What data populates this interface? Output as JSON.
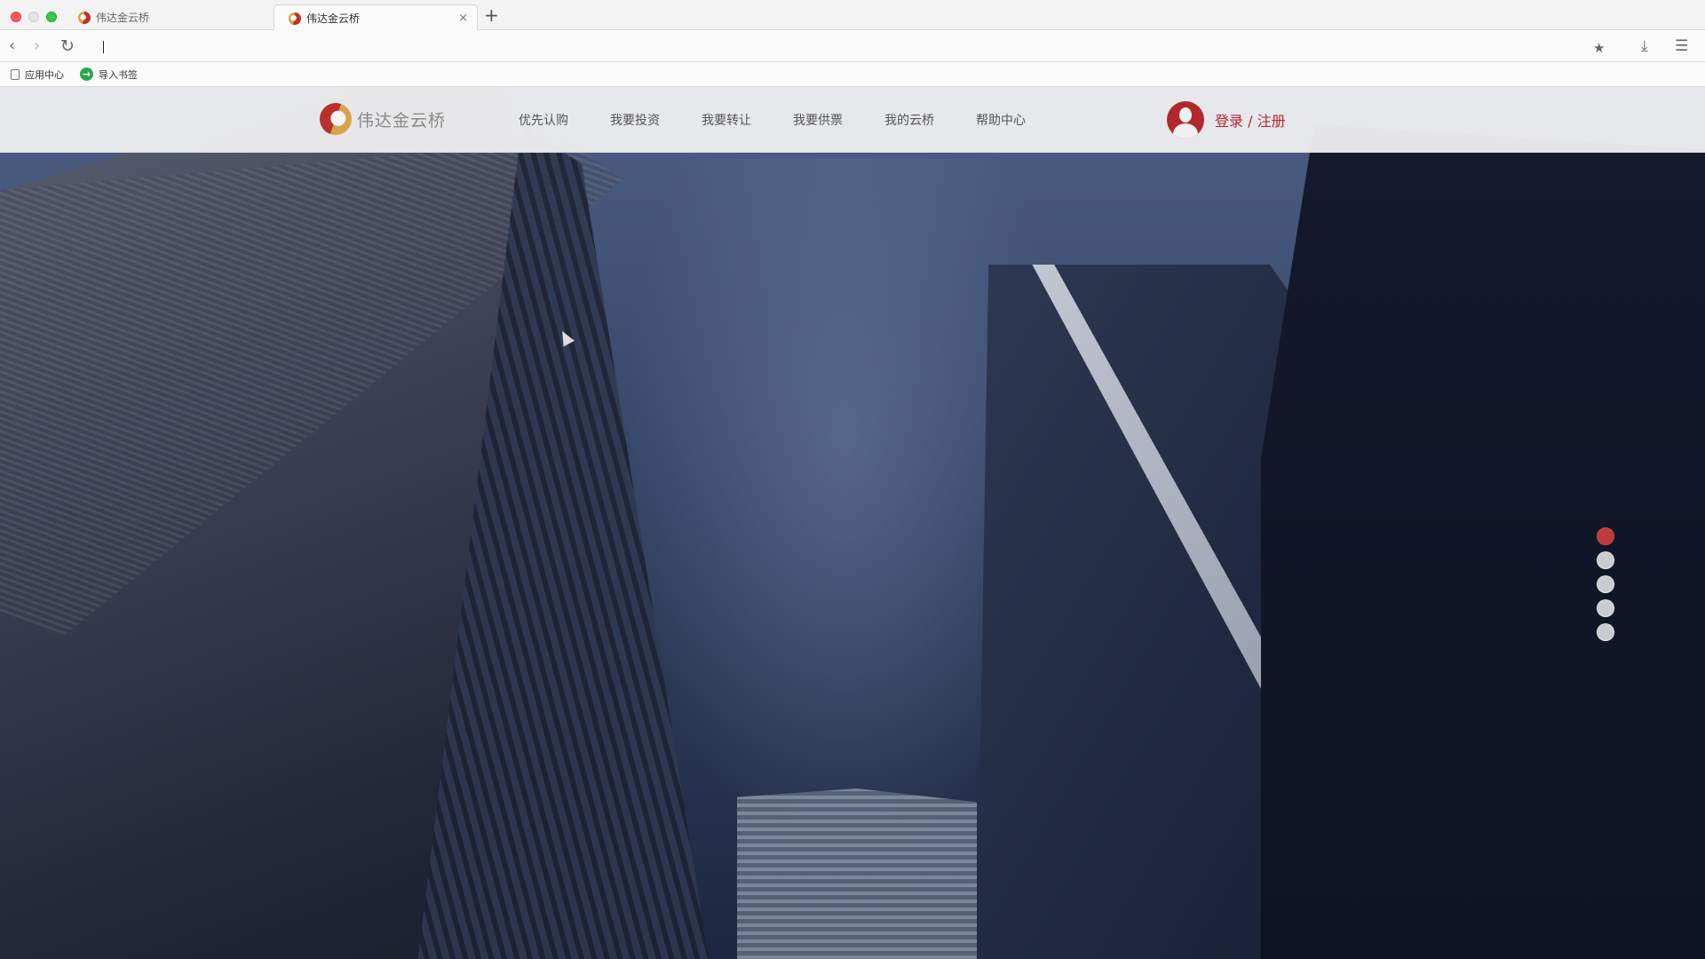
{
  "browser": {
    "tabs": [
      {
        "title": "伟达金云桥",
        "active": false
      },
      {
        "title": "伟达金云桥",
        "active": true
      }
    ],
    "new_tab_glyph": "+",
    "close_glyph": "×",
    "url": "",
    "bookmarks": [
      {
        "label": "应用中心",
        "icon": "app-center-icon"
      },
      {
        "label": "导入书签",
        "icon": "import-bookmark-icon"
      }
    ]
  },
  "site": {
    "logo_text": "伟达金云桥",
    "nav": [
      "优先认购",
      "我要投资",
      "我要转让",
      "我要供票",
      "我的云桥",
      "帮助中心"
    ],
    "login_label": "登录 / 注册",
    "accent_color": "#b3282d"
  },
  "carousel": {
    "slide_count": 5,
    "active_index": 0
  }
}
